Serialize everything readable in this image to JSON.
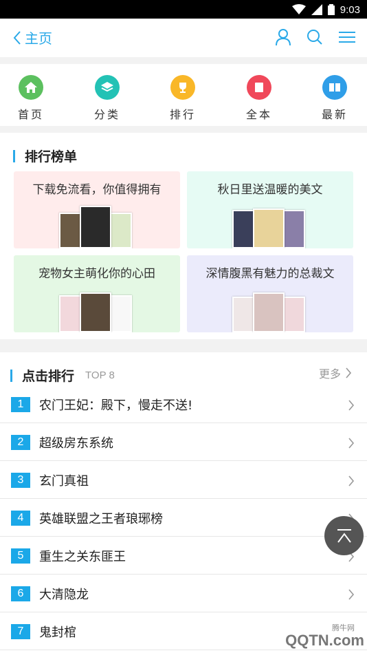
{
  "status": {
    "time": "9:03"
  },
  "topbar": {
    "back_label": "主页"
  },
  "nav": [
    {
      "label": "首页",
      "icon": "home-icon",
      "color": "#5cc05f"
    },
    {
      "label": "分类",
      "icon": "layers-icon",
      "color": "#23c2b5"
    },
    {
      "label": "排行",
      "icon": "trophy-icon",
      "color": "#f9b728"
    },
    {
      "label": "全本",
      "icon": "book-icon",
      "color": "#f0485a"
    },
    {
      "label": "最新",
      "icon": "open-book-icon",
      "color": "#2f9ee8"
    }
  ],
  "rank": {
    "title": "排行榜单",
    "cards": [
      {
        "title": "下载免流看，你值得拥有",
        "bg": "#ffecec"
      },
      {
        "title": "秋日里送温暖的美文",
        "bg": "#e6fbf4"
      },
      {
        "title": "宠物女主萌化你的心田",
        "bg": "#e4f8e4"
      },
      {
        "title": "深情腹黑有魅力的总裁文",
        "bg": "#ebebfb"
      }
    ]
  },
  "hot": {
    "title": "点击排行",
    "tag": "TOP 8",
    "more": "更多",
    "items": [
      {
        "rank": "1",
        "name": "农门王妃：殿下，慢走不送!"
      },
      {
        "rank": "2",
        "name": "超级房东系统"
      },
      {
        "rank": "3",
        "name": "玄门真祖"
      },
      {
        "rank": "4",
        "name": "英雄联盟之王者琅琊榜"
      },
      {
        "rank": "5",
        "name": "重生之关东匪王"
      },
      {
        "rank": "6",
        "name": "大清隐龙"
      },
      {
        "rank": "7",
        "name": "鬼封棺"
      }
    ]
  },
  "watermark": {
    "site": "腾牛网",
    "logo": "QQTN.com"
  }
}
